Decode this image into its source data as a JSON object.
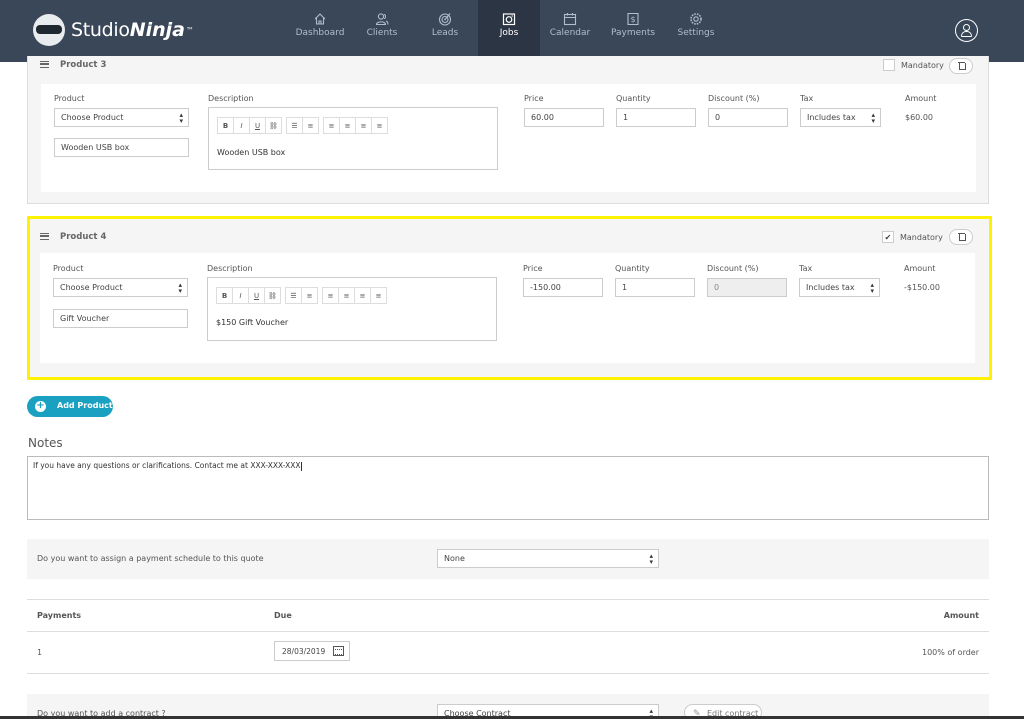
{
  "nav": {
    "brand_a": "Studio",
    "brand_b": "Ninja",
    "brand_tm": "™",
    "items": [
      {
        "label": "Dashboard",
        "icon": "home-icon"
      },
      {
        "label": "Clients",
        "icon": "clients-icon"
      },
      {
        "label": "Leads",
        "icon": "target-icon"
      },
      {
        "label": "Jobs",
        "icon": "camera-icon"
      },
      {
        "label": "Calendar",
        "icon": "calendar-icon"
      },
      {
        "label": "Payments",
        "icon": "dollar-icon"
      },
      {
        "label": "Settings",
        "icon": "gear-icon"
      }
    ],
    "active": "Jobs"
  },
  "columns": {
    "product": "Product",
    "description": "Description",
    "price": "Price",
    "quantity": "Quantity",
    "discount": "Discount (%)",
    "tax": "Tax",
    "amount": "Amount"
  },
  "toolbar": {
    "bold": "B",
    "italic": "I",
    "underline": "U"
  },
  "products": [
    {
      "title": "Product 3",
      "mandatory_label": "Mandatory",
      "mandatory": false,
      "choose": "Choose Product",
      "name": "Wooden USB box",
      "description": "Wooden USB box",
      "price": "60.00",
      "quantity": "1",
      "discount": "0",
      "tax": "Includes tax",
      "amount": "$60.00"
    },
    {
      "title": "Product 4",
      "mandatory_label": "Mandatory",
      "mandatory": true,
      "choose": "Choose Product",
      "name": "Gift Voucher",
      "description": "$150 Gift Voucher",
      "price": "-150.00",
      "quantity": "1",
      "discount": "0",
      "tax": "Includes tax",
      "amount": "-$150.00"
    }
  ],
  "add_product": "Add Product",
  "notes": {
    "title": "Notes",
    "text": "If you have any questions or clarifications. Contact me at XXX-XXX-XXX"
  },
  "payment_schedule": {
    "question": "Do you want to assign a payment schedule to this quote",
    "value": "None"
  },
  "payments_table": {
    "headers": {
      "payments": "Payments",
      "due": "Due",
      "amount": "Amount"
    },
    "rows": [
      {
        "number": "1",
        "due": "28/03/2019",
        "amount": "100% of order"
      }
    ]
  },
  "contract": {
    "question": "Do you want to add a contract ?",
    "value": "Choose Contract",
    "edit": "Edit contract"
  },
  "colors": {
    "nav_bg": "#3a4758",
    "nav_active": "#2b3543",
    "accent": "#1aa1c2",
    "highlight": "#fff200"
  }
}
